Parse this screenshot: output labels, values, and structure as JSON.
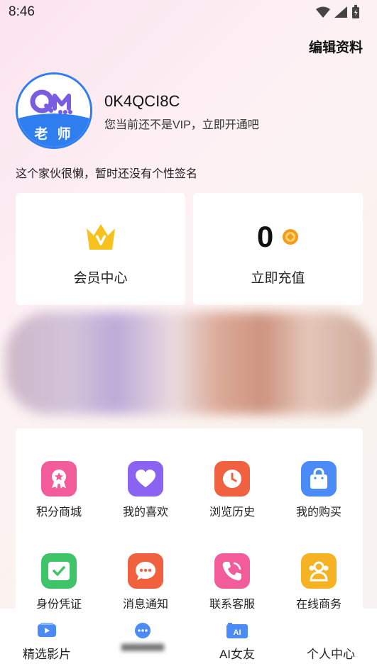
{
  "status_bar": {
    "time": "8:46"
  },
  "header": {
    "edit_profile": "编辑资料"
  },
  "profile": {
    "avatar_logo": "QM",
    "avatar_badge": "老 师",
    "username": "0K4QCI8C",
    "vip_text": "您当前还不是VIP，立即开通吧",
    "signature": "这个家伙很懒，暂时还没有个性签名"
  },
  "cards": {
    "member": {
      "label": "会员中心",
      "icon": "crown-icon"
    },
    "recharge": {
      "balance": "0",
      "label": "立即充值",
      "icon": "coin-icon"
    }
  },
  "menu": [
    {
      "label": "积分商城",
      "icon": "badge-icon",
      "color": "#f25c9b"
    },
    {
      "label": "我的喜欢",
      "icon": "heart-icon",
      "color": "#8a63f2"
    },
    {
      "label": "浏览历史",
      "icon": "clock-icon",
      "color": "#f0613f"
    },
    {
      "label": "我的购买",
      "icon": "bag-icon",
      "color": "#4b8bf5"
    },
    {
      "label": "身份凭证",
      "icon": "check-icon",
      "color": "#3fc46a"
    },
    {
      "label": "消息通知",
      "icon": "chat-icon",
      "color": "#f0613f"
    },
    {
      "label": "联系客服",
      "icon": "phone-icon",
      "color": "#f25c9b"
    },
    {
      "label": "在线商务",
      "icon": "people-icon",
      "color": "#f5b324"
    }
  ],
  "tabs": [
    {
      "label": "精选影片",
      "icon": "video-icon"
    },
    {
      "label": "",
      "icon": "chat-bubble-icon"
    },
    {
      "label": "AI女友",
      "icon": "ai-image-icon"
    },
    {
      "label": "个人中心",
      "icon": ""
    }
  ],
  "colors": {
    "accent_blue": "#2f7ef0",
    "gold": "#f5b324"
  }
}
